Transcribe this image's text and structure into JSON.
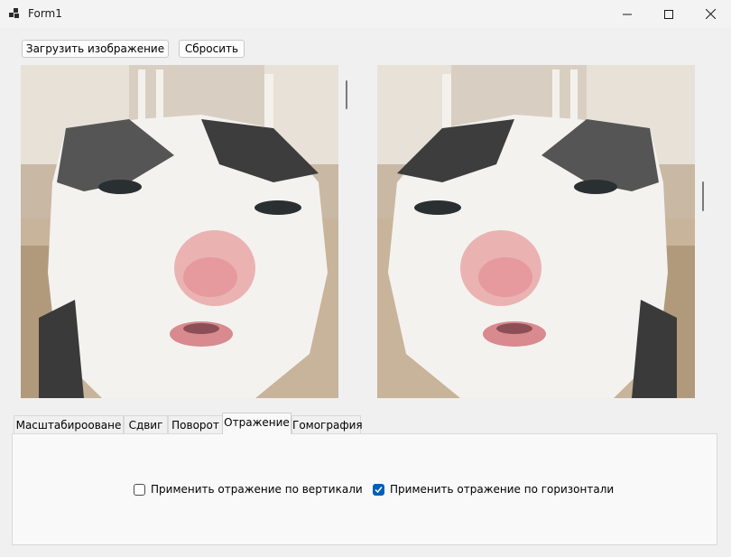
{
  "window": {
    "title": "Form1"
  },
  "toolbar": {
    "load_label": "Загрузить изображение",
    "reset_label": "Сбросить"
  },
  "images": {
    "source": {
      "description": "original"
    },
    "result": {
      "description": "flipped-horizontal"
    }
  },
  "tabs": [
    {
      "label": "Масштабирооване"
    },
    {
      "label": "Сдвиг"
    },
    {
      "label": "Поворот"
    },
    {
      "label": "Отражение",
      "active": true
    },
    {
      "label": "Гомография"
    }
  ],
  "reflection": {
    "vertical_label": "Применить отражение по вертикали",
    "vertical_checked": false,
    "horizontal_label": "Применить отражение по горизонтали",
    "horizontal_checked": true
  },
  "colors": {
    "accent": "#005fb8",
    "window_bg": "#f0f0f0"
  }
}
